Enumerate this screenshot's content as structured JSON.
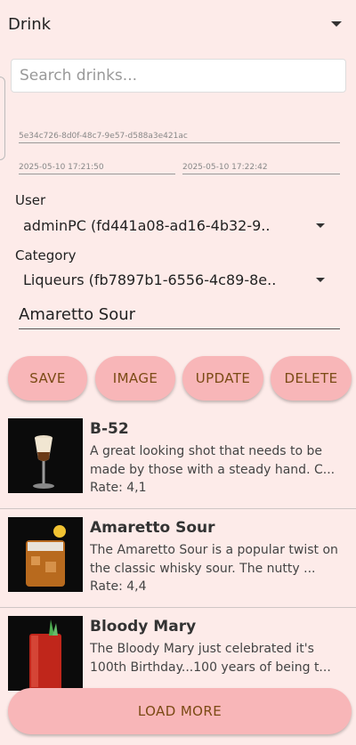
{
  "app": {
    "title": "Drink"
  },
  "search": {
    "placeholder": "Search drinks..."
  },
  "record": {
    "id": "5e34c726-8d0f-48c7-9e57-d588a3e421ac",
    "created": "2025-05-10 17:21:50",
    "updated": "2025-05-10 17:22:42"
  },
  "user": {
    "label": "User",
    "value": "adminPC (fd441a08-ad16-4b32-9.."
  },
  "category": {
    "label": "Category",
    "value": "Liqueurs (fb7897b1-6556-4c89-8e.."
  },
  "name_field": {
    "value": "Amaretto Sour"
  },
  "buttons": {
    "save": "SAVE",
    "image": "IMAGE",
    "update": "UPDATE",
    "delete": "DELETE",
    "load_more": "LOAD MORE"
  },
  "drinks": [
    {
      "title": "B-52",
      "description": "A great looking shot that needs to be made by those with a steady hand. C...",
      "rate": "Rate: 4,1"
    },
    {
      "title": "Amaretto Sour",
      "description": "The Amaretto Sour is a popular twist on the classic whisky sour. The nutty ...",
      "rate": "Rate: 4,4"
    },
    {
      "title": "Bloody Mary",
      "description": "The Bloody Mary just celebrated it's 100th Birthday...100 years of being t...",
      "rate": ""
    }
  ]
}
